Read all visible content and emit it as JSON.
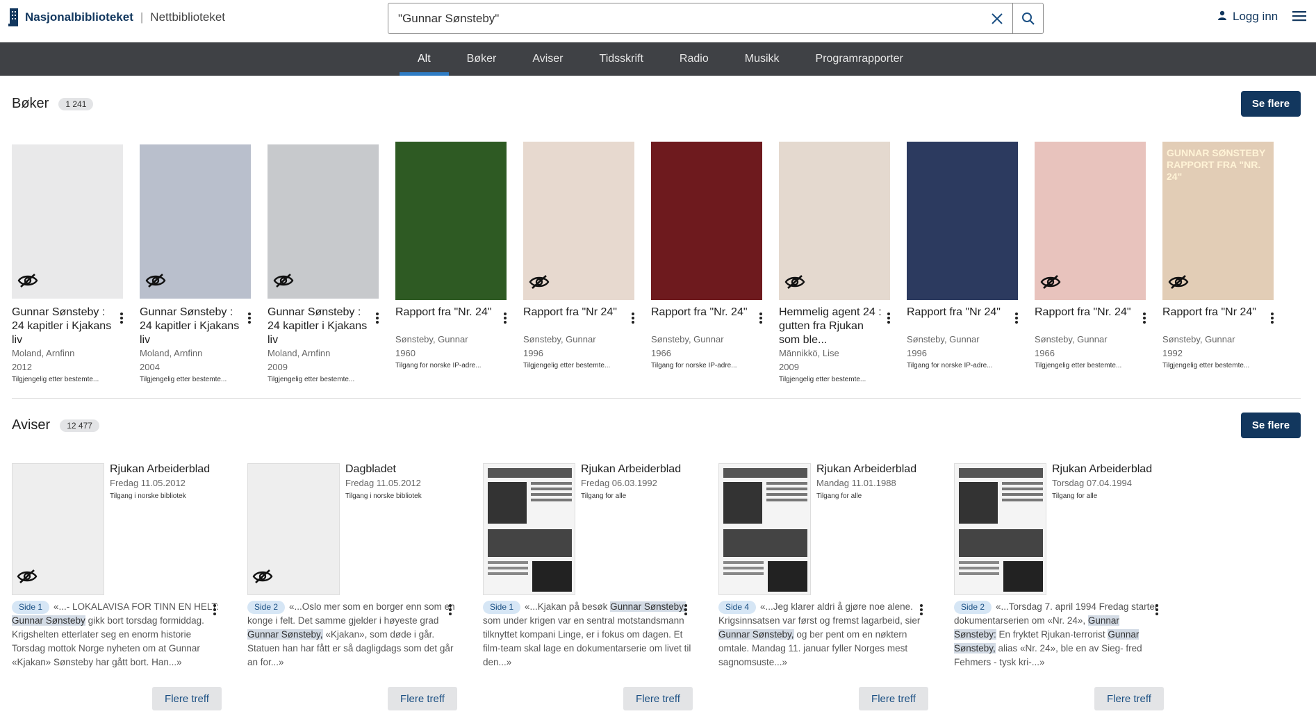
{
  "header": {
    "brand": "Nasjonalbiblioteket",
    "separator": "|",
    "site": "Nettbiblioteket",
    "search_value": "\"Gunnar Sønsteby\"",
    "login_label": "Logg inn"
  },
  "tabs": [
    "Alt",
    "Bøker",
    "Aviser",
    "Tidsskrift",
    "Radio",
    "Musikk",
    "Programrapporter"
  ],
  "books_section": {
    "title": "Bøker",
    "count": "1 241",
    "more_label": "Se flere",
    "items": [
      {
        "title": "Gunnar Sønsteby : 24 kapitler i Kjakans liv",
        "author": "Moland, Arnfinn",
        "year": "2012",
        "access": "Tilgjengelig etter bestemte...",
        "cover_color": "#e9e9ea",
        "restricted": true
      },
      {
        "title": "Gunnar Sønsteby : 24 kapitler i Kjakans liv",
        "author": "Moland, Arnfinn",
        "year": "2004",
        "access": "Tilgjengelig etter bestemte...",
        "cover_color": "#b9bfcc",
        "restricted": true
      },
      {
        "title": "Gunnar Sønsteby : 24 kapitler i Kjakans liv",
        "author": "Moland, Arnfinn",
        "year": "2009",
        "access": "Tilgjengelig etter bestemte...",
        "cover_color": "#c7c9cc",
        "restricted": true
      },
      {
        "title": "Rapport fra \"Nr. 24\"",
        "author": "Sønsteby, Gunnar",
        "year": "1960",
        "access": "Tilgang for norske IP-adre...",
        "cover_color": "#2e5a23",
        "restricted": false
      },
      {
        "title": "Rapport fra \"Nr 24\"",
        "author": "Sønsteby, Gunnar",
        "year": "1996",
        "access": "Tilgjengelig etter bestemte...",
        "cover_color": "#e7d9cf",
        "restricted": true
      },
      {
        "title": "Rapport fra \"Nr. 24\"",
        "author": "Sønsteby, Gunnar",
        "year": "1966",
        "access": "Tilgang for norske IP-adre...",
        "cover_color": "#6e1a1e",
        "restricted": false
      },
      {
        "title": "Hemmelig agent 24 : gutten fra Rjukan som ble...",
        "author": "Männikkö, Lise",
        "year": "2009",
        "access": "Tilgjengelig etter bestemte...",
        "cover_color": "#e4d9cf",
        "restricted": true
      },
      {
        "title": "Rapport fra \"Nr 24\"",
        "author": "Sønsteby, Gunnar",
        "year": "1996",
        "access": "Tilgang for norske IP-adre...",
        "cover_color": "#2c3a5f",
        "restricted": false
      },
      {
        "title": "Rapport fra \"Nr. 24\"",
        "author": "Sønsteby, Gunnar",
        "year": "1966",
        "access": "Tilgjengelig etter bestemte...",
        "cover_color": "#e8c3bd",
        "restricted": true
      },
      {
        "title": "Rapport fra \"Nr 24\"",
        "author": "Sønsteby, Gunnar",
        "year": "1992",
        "access": "Tilgjengelig etter bestemte...",
        "cover_color": "#e2cdb6",
        "restricted": true,
        "cover_text": "GUNNAR SØNSTEBY\nRAPPORT FRA \"NR. 24\""
      }
    ]
  },
  "papers_section": {
    "title": "Aviser",
    "count": "12 477",
    "more_label": "Se flere",
    "hits_label": "Flere treff",
    "items": [
      {
        "name": "Rjukan Arbeiderblad",
        "date": "Fredag 11.05.2012",
        "access": "Tilgang i norske bibliotek",
        "side": "Side 1",
        "restricted": true,
        "segments": [
          [
            "«...- LOKALAVISA FOR TINN EN HELT: ",
            false
          ],
          [
            "Gunnar Sønsteby",
            true
          ],
          [
            " gikk bort torsdag formiddag. Krigshelten etterlater seg en enorm historie Torsdag mottok Norge nyheten om at Gunnar «Kjakan» Sønsteby har gått bort. Han...»",
            false
          ]
        ]
      },
      {
        "name": "Dagbladet",
        "date": "Fredag 11.05.2012",
        "access": "Tilgang i norske bibliotek",
        "side": "Side 2",
        "restricted": true,
        "segments": [
          [
            "«...Oslo mer som en borger enn som en konge i felt. Det samme gjelder i høyeste grad ",
            false
          ],
          [
            "Gunnar Sønsteby,",
            true
          ],
          [
            " «Kjakan», som døde i går. Statuen han har fått er så dagligdags som det går an for...»",
            false
          ]
        ]
      },
      {
        "name": "Rjukan Arbeiderblad",
        "date": "Fredag 06.03.1992",
        "access": "Tilgang for alle",
        "side": "Side 1",
        "restricted": false,
        "segments": [
          [
            "«...Kjakan på besøk ",
            false
          ],
          [
            "Gunnar Sønsteby,",
            true
          ],
          [
            " som under krigen var en sentral motstandsmann tilknyttet kompani Linge, er i fokus om dagen. Et film-team skal lage en dokumentarserie om livet til den...»",
            false
          ]
        ]
      },
      {
        "name": "Rjukan Arbeiderblad",
        "date": "Mandag 11.01.1988",
        "access": "Tilgang for alle",
        "side": "Side 4",
        "restricted": false,
        "segments": [
          [
            "«...Jeg klarer aldri å gjøre noe alene. Krigsinnsatsen var først og fremst lagarbeid, sier ",
            false
          ],
          [
            "Gunnar Sønsteby,",
            true
          ],
          [
            " og ber pent om en nøktern omtale. Mandag 11. januar fyller Norges mest sagnomsuste...»",
            false
          ]
        ]
      },
      {
        "name": "Rjukan Arbeiderblad",
        "date": "Torsdag 07.04.1994",
        "access": "Tilgang for alle",
        "side": "Side 2",
        "restricted": false,
        "segments": [
          [
            "«...Torsdag 7. april 1994 Fredag starter dokumentarserien om «Nr. 24», ",
            false
          ],
          [
            "Gunnar Sønsteby:",
            true
          ],
          [
            " En fryktet Rjukan-terrorist ",
            false
          ],
          [
            "Gunnar Sønsteby,",
            true
          ],
          [
            " alias «Nr. 24», ble en av Sieg- fred Fehmers - tysk kri-...»",
            false
          ]
        ]
      }
    ]
  },
  "colors": {
    "brand": "#12375e",
    "nav_bg": "#3f4145",
    "tab_indicator": "#2f7cc4",
    "highlight": "#d3dbe5"
  },
  "icons": [
    "library-logo-icon",
    "close-icon",
    "search-icon",
    "user-icon",
    "hamburger-menu-icon",
    "eye-off-icon",
    "more-vert-icon"
  ]
}
